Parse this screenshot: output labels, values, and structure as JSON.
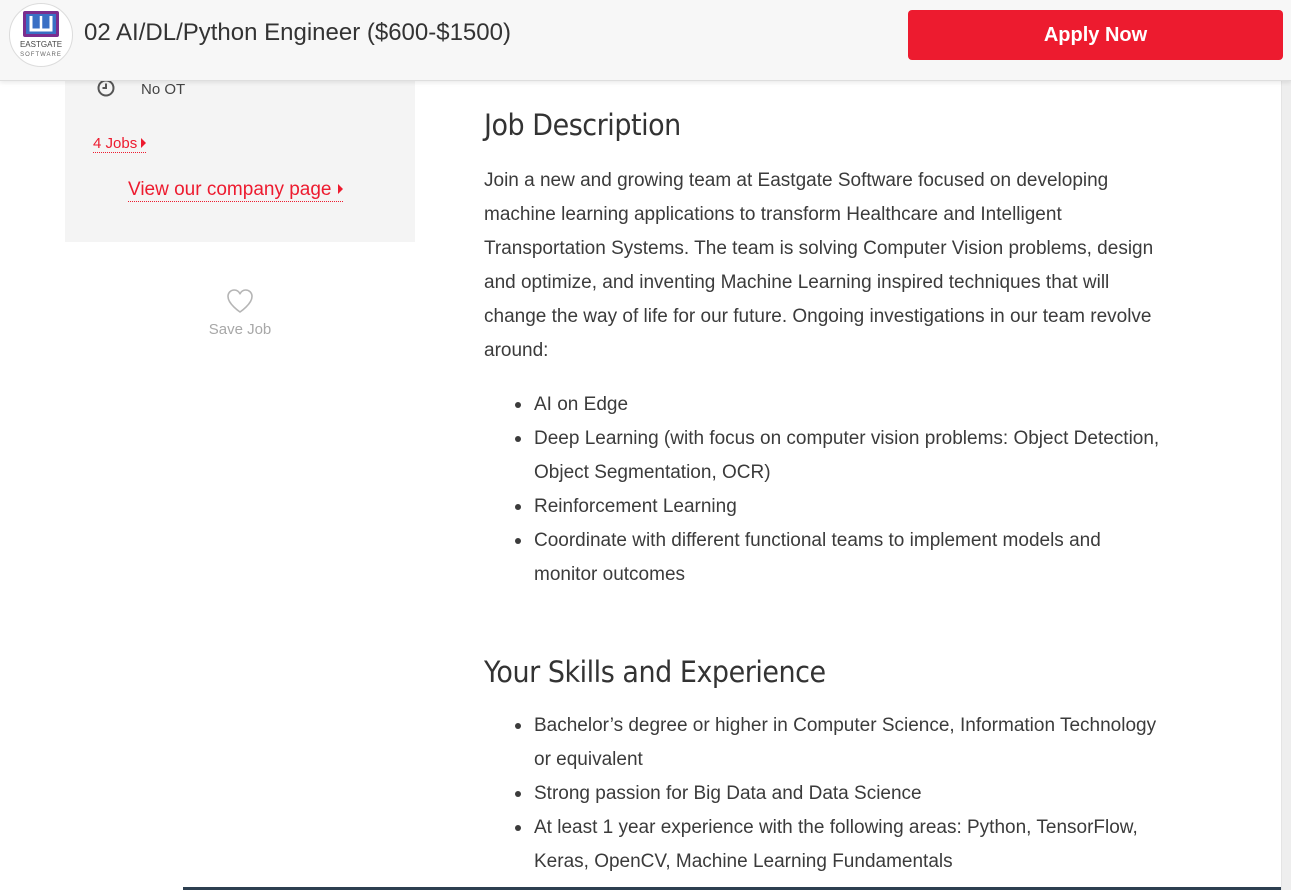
{
  "header": {
    "logo_text": "EASTGATE SOFTWARE",
    "job_title": "02 AI/DL/Python Engineer ($600-$1500)",
    "apply_label": "Apply Now",
    "accent_color": "#ed1b2f"
  },
  "sidebar": {
    "overtime": {
      "icon": "clock-icon",
      "text": "No OT"
    },
    "jobs_link": "4 Jobs",
    "company_link": "View our company page",
    "save_job": {
      "icon": "heart-icon",
      "label": "Save Job"
    }
  },
  "job_description": {
    "heading": "Job Description",
    "paragraph": "Join a new and growing team at Eastgate Software focused on developing machine learning applications to transform Healthcare and Intelligent Transportation Systems. The team is solving Computer Vision problems, design and optimize, and inventing Machine Learning inspired techniques that will change the way of life for our future. Ongoing investigations in our team revolve around:",
    "items": [
      "AI on Edge",
      "Deep Learning (with focus on computer vision problems: Object Detection, Object Segmentation, OCR)",
      "Reinforcement Learning",
      "Coordinate with different functional teams to implement models and monitor outcomes"
    ]
  },
  "skills": {
    "heading": "Your Skills and Experience",
    "items": [
      "Bachelor’s degree or higher in Computer Science, Information Technology or equivalent",
      "Strong passion for Big Data and Data Science",
      "At least 1 year experience with the following areas: Python, TensorFlow, Keras, OpenCV, Machine Learning Fundamentals"
    ]
  }
}
